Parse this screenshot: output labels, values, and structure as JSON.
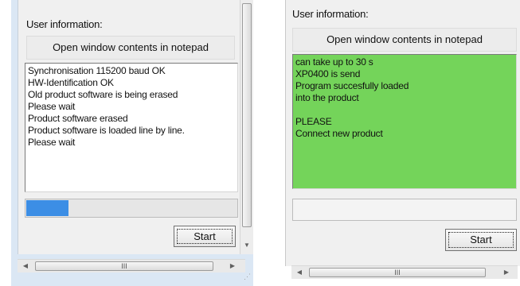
{
  "left": {
    "user_info_label": "User information:",
    "open_notepad_label": "Open window contents in notepad",
    "log_lines": [
      "Synchronisation 115200 baud OK",
      "HW-Identification OK",
      "Old product software is being erased",
      "Please wait",
      "Product software erased",
      "Product software is loaded line by line.",
      "Please wait"
    ],
    "progress_fraction": 0.2,
    "start_label": "Start",
    "scroll_thumb_glyph": "III"
  },
  "right": {
    "user_info_label": "User information:",
    "open_notepad_label": "Open window contents in notepad",
    "log_lines": [
      "can take up to 30 s",
      "XP0400 is send",
      "Program succesfully loaded",
      "into the product",
      "",
      "PLEASE",
      "Connect new product"
    ],
    "progress_fraction": 0,
    "start_label": "Start",
    "scroll_thumb_glyph": "III"
  },
  "colors": {
    "success_background": "#74d45a",
    "progress_fill": "#3c8ee5",
    "panel_background": "#f0f0f0"
  },
  "icons": {
    "scroll_left": "left-arrow-icon",
    "scroll_right": "right-arrow-icon",
    "scroll_down": "down-arrow-icon"
  }
}
